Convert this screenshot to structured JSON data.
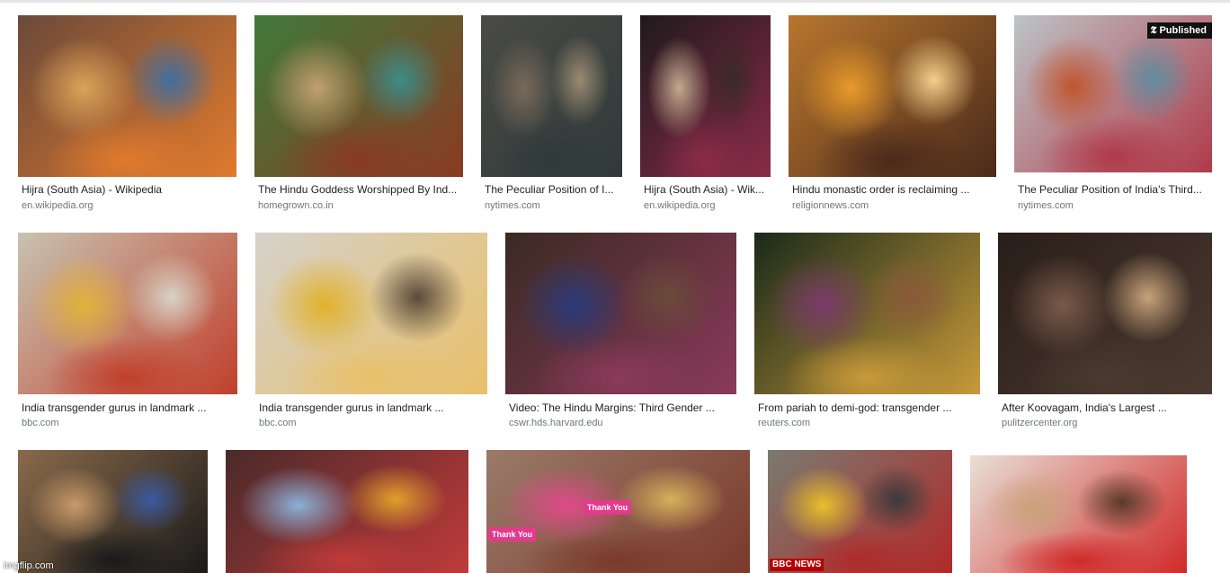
{
  "results": [
    {
      "caption": "Hijra (South Asia) - Wikipedia",
      "domain": "en.wikipedia.org",
      "palette": [
        "#6b4a3a",
        "#d9a35a",
        "#e07a2e",
        "#3e6fa0"
      ]
    },
    {
      "caption": "The Hindu Goddess Worshipped By Ind...",
      "domain": "homegrown.co.in",
      "palette": [
        "#3f7a3a",
        "#c2a070",
        "#8a3a22",
        "#3c8c8a"
      ]
    },
    {
      "caption": "The Peculiar Position of I...",
      "domain": "nytimes.com",
      "palette": [
        "#4a4a45",
        "#7a6a5a",
        "#2f3a3a",
        "#9a8a70"
      ]
    },
    {
      "caption": "Hijra (South Asia) - Wik...",
      "domain": "en.wikipedia.org",
      "palette": [
        "#1f1a1c",
        "#c2a98e",
        "#8a2b4a",
        "#3a2a2a"
      ]
    },
    {
      "caption": "Hindu monastic order is reclaiming ...",
      "domain": "religionnews.com",
      "palette": [
        "#b8762e",
        "#e89a2a",
        "#4a2a1a",
        "#f2cf8a"
      ]
    },
    {
      "caption": "The Peculiar Position of India's Third...",
      "domain": "nytimes.com",
      "badge": "Published",
      "palette": [
        "#bcc4c6",
        "#c0552f",
        "#b03a4a",
        "#5f8da0"
      ]
    },
    {
      "caption": "India transgender gurus in landmark ...",
      "domain": "bbc.com",
      "palette": [
        "#c8c2b0",
        "#e0b33a",
        "#c0402c",
        "#d8d3c6"
      ]
    },
    {
      "caption": "India transgender gurus in landmark ...",
      "domain": "bbc.com",
      "palette": [
        "#d6d1ca",
        "#e0b22a",
        "#e8c06a",
        "#5a4a3a"
      ]
    },
    {
      "caption": "Video: The Hindu Margins: Third Gender ...",
      "domain": "cswr.hds.harvard.edu",
      "palette": [
        "#3a2a22",
        "#2a3a7a",
        "#8a3a5a",
        "#6a4a3a"
      ]
    },
    {
      "caption": "From pariah to demi-god: transgender ...",
      "domain": "reuters.com",
      "palette": [
        "#1a2a1a",
        "#7a3a6a",
        "#c89a3a",
        "#8a5a3a"
      ]
    },
    {
      "caption": "After Koovagam, India's Largest ...",
      "domain": "pulitzercenter.org",
      "palette": [
        "#2a1e1a",
        "#7a5a4a",
        "#4a3a30",
        "#c8a27a"
      ]
    },
    {
      "palette": [
        "#8a6a4a",
        "#c89a6a",
        "#1a1a1a",
        "#3a5aa0"
      ],
      "watermark": "imgflip.com"
    },
    {
      "palette": [
        "#4a2a2a",
        "#8ab0d8",
        "#c03a3a",
        "#e0a02a"
      ]
    },
    {
      "palette": [
        "#9a7a6a",
        "#e04a8a",
        "#7a3a2a",
        "#d8b05a"
      ],
      "signs": [
        "Thank You",
        "Thank You"
      ]
    },
    {
      "palette": [
        "#7a7a70",
        "#e8c02a",
        "#b02a2a",
        "#3a3a3a"
      ],
      "news": "BBC NEWS"
    },
    {
      "palette": [
        "#e8e0d6",
        "#c8a27a",
        "#d02a2a",
        "#5a3a2a"
      ]
    }
  ]
}
